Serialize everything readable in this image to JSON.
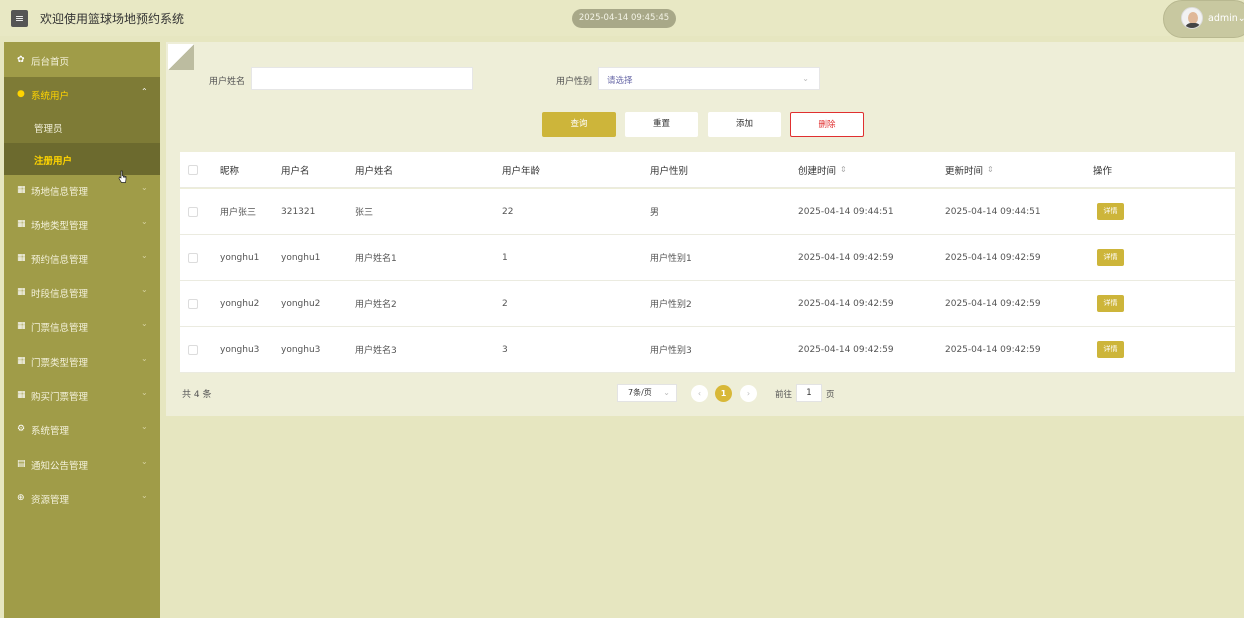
{
  "header": {
    "menu_icon": "hamburger-icon",
    "title": "欢迎使用篮球场地预约系统",
    "datetime": "2025-04-14 09:45:45",
    "username": "admin",
    "user_caret": "⌄"
  },
  "sidebar": {
    "items": [
      {
        "label": "后台首页",
        "icon": "home-icon",
        "glyph": "✿",
        "arrow": ""
      },
      {
        "label": "系统用户",
        "icon": "user-icon",
        "glyph": "👤",
        "arrow": "⌃"
      },
      {
        "label": "场地信息管理",
        "icon": "grid-icon",
        "glyph": "▦",
        "arrow": "⌄"
      },
      {
        "label": "场地类型管理",
        "icon": "grid-icon",
        "glyph": "▦",
        "arrow": "⌄"
      },
      {
        "label": "预约信息管理",
        "icon": "grid-icon",
        "glyph": "▦",
        "arrow": "⌄"
      },
      {
        "label": "时段信息管理",
        "icon": "grid-icon",
        "glyph": "▦",
        "arrow": "⌄"
      },
      {
        "label": "门票信息管理",
        "icon": "grid-icon",
        "glyph": "▦",
        "arrow": "⌄"
      },
      {
        "label": "门票类型管理",
        "icon": "grid-icon",
        "glyph": "▦",
        "arrow": "⌄"
      },
      {
        "label": "购买门票管理",
        "icon": "grid-icon",
        "glyph": "▦",
        "arrow": "⌄"
      },
      {
        "label": "系统管理",
        "icon": "gear-icon",
        "glyph": "⚙",
        "arrow": "⌄"
      },
      {
        "label": "通知公告管理",
        "icon": "notice-icon",
        "glyph": "▤",
        "arrow": "⌄"
      },
      {
        "label": "资源管理",
        "icon": "plus-circle-icon",
        "glyph": "⊕",
        "arrow": "⌄"
      }
    ],
    "subitems": [
      {
        "label": "管理员"
      },
      {
        "label": "注册用户"
      }
    ]
  },
  "search": {
    "name_label": "用户姓名",
    "name_value": "",
    "gender_label": "用户性别",
    "gender_placeholder": "请选择"
  },
  "buttons": {
    "query": "查询",
    "reset": "重置",
    "add": "添加",
    "delete": "删除"
  },
  "table": {
    "headers": [
      "昵称",
      "用户名",
      "用户姓名",
      "用户年龄",
      "用户性别",
      "创建时间",
      "更新时间",
      "操作"
    ],
    "sort_icon": "⇕",
    "rows": [
      {
        "nickname": "用户张三",
        "username": "321321",
        "realname": "张三",
        "age": "22",
        "gender": "男",
        "created": "2025-04-14 09:44:51",
        "updated": "2025-04-14 09:44:51",
        "action": "详情"
      },
      {
        "nickname": "yonghu1",
        "username": "yonghu1",
        "realname": "用户姓名1",
        "age": "1",
        "gender": "用户性别1",
        "created": "2025-04-14 09:42:59",
        "updated": "2025-04-14 09:42:59",
        "action": "详情"
      },
      {
        "nickname": "yonghu2",
        "username": "yonghu2",
        "realname": "用户姓名2",
        "age": "2",
        "gender": "用户性别2",
        "created": "2025-04-14 09:42:59",
        "updated": "2025-04-14 09:42:59",
        "action": "详情"
      },
      {
        "nickname": "yonghu3",
        "username": "yonghu3",
        "realname": "用户姓名3",
        "age": "3",
        "gender": "用户性别3",
        "created": "2025-04-14 09:42:59",
        "updated": "2025-04-14 09:42:59",
        "action": "详情"
      }
    ]
  },
  "pagination": {
    "total": "共 4 条",
    "page_size": "7条/页",
    "prev": "‹",
    "current": "1",
    "next": "›",
    "goto_prefix": "前往",
    "goto_value": "1",
    "goto_suffix": "页"
  },
  "colors": {
    "sidebar_bg": "#a09c48",
    "sidebar_active": "#7e7b36",
    "accent": "#cdb53a",
    "danger": "#e03030",
    "page_bg": "#e6e6c0"
  }
}
